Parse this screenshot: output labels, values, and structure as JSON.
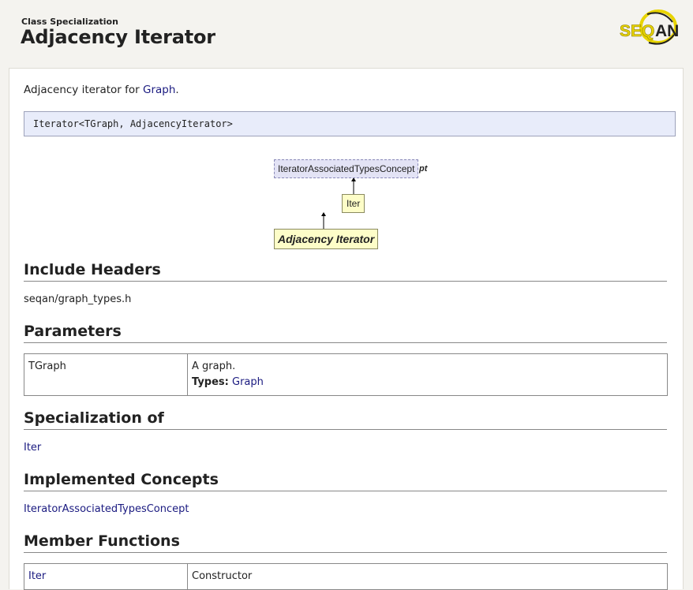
{
  "header": {
    "kind": "Class Specialization",
    "title": "Adjacency Iterator",
    "logo_text": "SEQAN"
  },
  "summary": {
    "prefix": "Adjacency iterator for ",
    "link": "Graph",
    "suffix": "."
  },
  "signature": "Iterator<TGraph, AdjacencyIterator>",
  "diagram": {
    "concept_node": "IteratorAssociatedTypesConcept",
    "concept_overflow": "pt",
    "iter_node": "Iter",
    "self_node": "Adjacency Iterator"
  },
  "include_headers": {
    "heading": "Include Headers",
    "value": "seqan/graph_types.h"
  },
  "parameters": {
    "heading": "Parameters",
    "rows": [
      {
        "name": "TGraph",
        "description": "A graph.",
        "types_label": "Types:",
        "types_value": "Graph"
      }
    ]
  },
  "specialization_of": {
    "heading": "Specialization of",
    "value": "Iter"
  },
  "implemented_concepts": {
    "heading": "Implemented Concepts",
    "value": "IteratorAssociatedTypesConcept"
  },
  "member_functions": {
    "heading": "Member Functions",
    "rows": [
      {
        "name": "Iter",
        "description": "Constructor"
      }
    ]
  },
  "colors": {
    "page_background": "#f4f3ef",
    "link": "#1a1a80",
    "signature_background": "#e8ecfa",
    "concept_node_background": "#e3e3f5",
    "class_node_background": "#fdfdc8",
    "logo_yellow": "#e8d400"
  }
}
